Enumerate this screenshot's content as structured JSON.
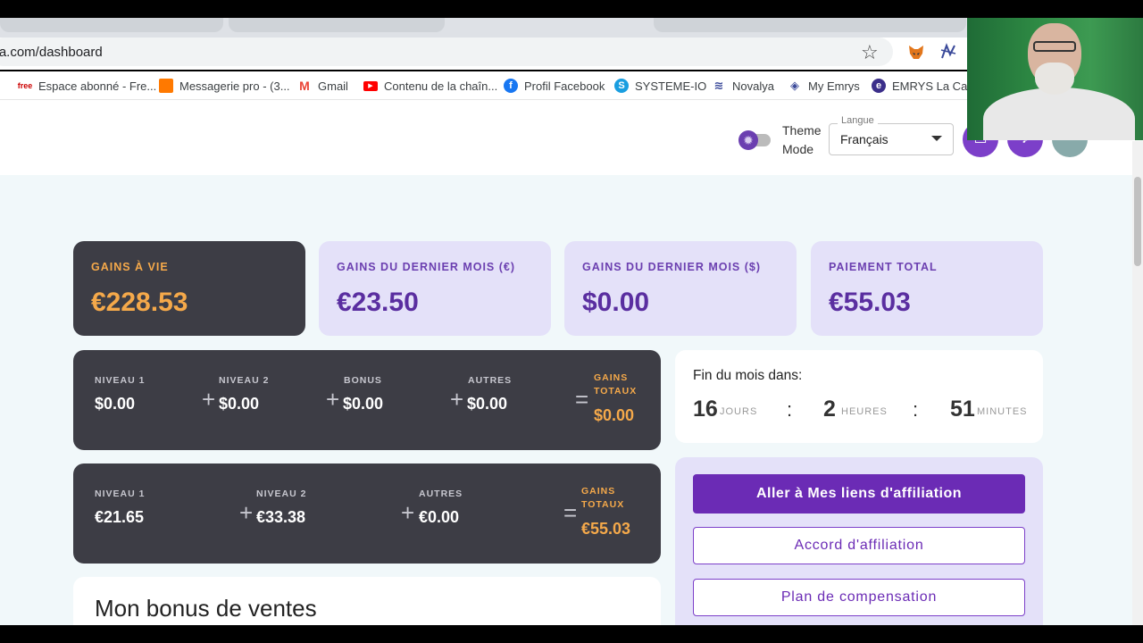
{
  "browser": {
    "url": "lya.com/dashboard",
    "bookmarks": [
      {
        "label": "Espace abonné - Fre...",
        "icon": "free-icon",
        "color": "#cc0000"
      },
      {
        "label": "Messagerie pro - (3...",
        "icon": "orange-icon",
        "color": "#ff7900"
      },
      {
        "label": "Gmail",
        "icon": "gmail-icon",
        "color": "#ea4335"
      },
      {
        "label": "Contenu de la chaîn...",
        "icon": "youtube-icon",
        "color": "#ff0000"
      },
      {
        "label": "Profil Facebook",
        "icon": "facebook-icon",
        "color": "#1877f2"
      },
      {
        "label": "SYSTEME-IO",
        "icon": "systemeio-icon",
        "color": "#1a9ee0"
      },
      {
        "label": "Novalya",
        "icon": "novalya-icon",
        "color": "#3b4a9a"
      },
      {
        "label": "My Emrys",
        "icon": "emrys-icon",
        "color": "#3b4a9a"
      },
      {
        "label": "EMRYS La Carte",
        "icon": "emrys-card-icon",
        "color": "#3b2e8a"
      }
    ]
  },
  "header": {
    "theme_label": "Theme Mode",
    "language_legend": "Langue",
    "language_value": "Français"
  },
  "stats": [
    {
      "label": "GAINS À VIE",
      "value": "€228.53"
    },
    {
      "label": "GAINS DU DERNIER MOIS (€)",
      "value": "€23.50"
    },
    {
      "label": "GAINS DU DERNIER MOIS ($)",
      "value": "$0.00"
    },
    {
      "label": "PAIEMENT TOTAL",
      "value": "€55.03"
    }
  ],
  "row1": {
    "cells": [
      {
        "label": "NIVEAU 1",
        "value": "$0.00"
      },
      {
        "label": "NIVEAU 2",
        "value": "$0.00"
      },
      {
        "label": "BONUS",
        "value": "$0.00"
      },
      {
        "label": "AUTRES",
        "value": "$0.00"
      }
    ],
    "total_label_1": "GAINS",
    "total_label_2": "TOTAUX",
    "total_value": "$0.00"
  },
  "row2": {
    "cells": [
      {
        "label": "NIVEAU 1",
        "value": "€21.65"
      },
      {
        "label": "NIVEAU 2",
        "value": "€33.38"
      },
      {
        "label": "AUTRES",
        "value": "€0.00"
      }
    ],
    "total_label_1": "GAINS",
    "total_label_2": "TOTAUX",
    "total_value": "€55.03"
  },
  "countdown": {
    "title": "Fin du mois dans:",
    "days": "16",
    "days_unit": "JOURS",
    "hours": "2",
    "hours_unit": "HEURES",
    "minutes": "51",
    "minutes_unit": "MINUTES"
  },
  "actions": {
    "primary": "Aller à Mes liens d'affiliation",
    "agreement": "Accord d'affiliation",
    "plan": "Plan de compensation"
  },
  "bonus": {
    "title": "Mon bonus de ventes"
  },
  "colors": {
    "accent": "#6b2bb5",
    "orange": "#f5a94a",
    "dark_card": "#3d3d45",
    "light_card": "#e4e1f9"
  }
}
